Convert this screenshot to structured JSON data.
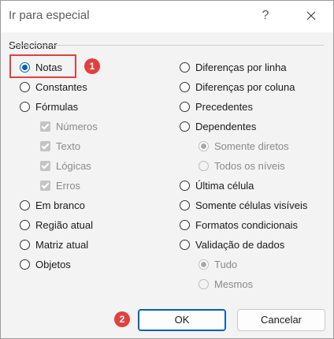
{
  "window": {
    "title": "Ir para especial",
    "help_label": "?"
  },
  "group": {
    "label": "Selecionar"
  },
  "left_options": [
    {
      "label": "Notas"
    },
    {
      "label": "Constantes"
    },
    {
      "label": "Fórmulas"
    },
    {
      "label": "Números"
    },
    {
      "label": "Texto"
    },
    {
      "label": "Lógicas"
    },
    {
      "label": "Erros"
    },
    {
      "label": "Em branco"
    },
    {
      "label": "Região atual"
    },
    {
      "label": "Matriz atual"
    },
    {
      "label": "Objetos"
    }
  ],
  "right_options": [
    {
      "label": "Diferenças por linha"
    },
    {
      "label": "Diferenças por coluna"
    },
    {
      "label": "Precedentes"
    },
    {
      "label": "Dependentes"
    },
    {
      "label": "Somente diretos"
    },
    {
      "label": "Todos os níveis"
    },
    {
      "label": "Última célula"
    },
    {
      "label": "Somente células visíveis"
    },
    {
      "label": "Formatos condicionais"
    },
    {
      "label": "Validação de dados"
    },
    {
      "label": "Tudo"
    },
    {
      "label": "Mesmos"
    }
  ],
  "annotations": {
    "step1": "1",
    "step2": "2"
  },
  "buttons": {
    "ok": "OK",
    "cancel": "Cancelar"
  },
  "colors": {
    "accent": "#005fb8",
    "annotation": "#e0413e"
  }
}
